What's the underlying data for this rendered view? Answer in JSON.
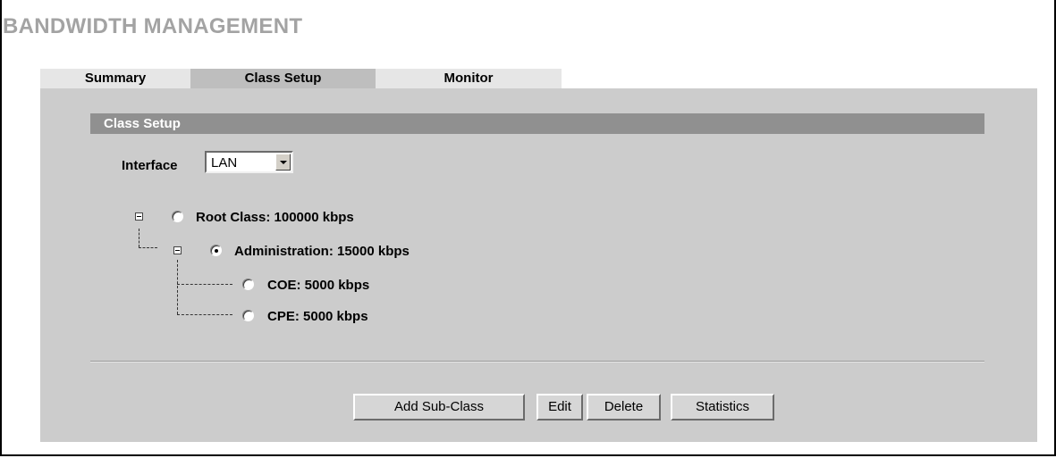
{
  "page": {
    "title": "BANDWIDTH MANAGEMENT"
  },
  "tabs": [
    {
      "label": "Summary",
      "active": false
    },
    {
      "label": "Class Setup",
      "active": true
    },
    {
      "label": "Monitor",
      "active": false
    }
  ],
  "section": {
    "title": "Class Setup"
  },
  "interface": {
    "label": "Interface",
    "selected": "LAN"
  },
  "tree": {
    "nodes": [
      {
        "label": "Root Class: 100000 kbps",
        "selected": false,
        "expandable": true
      },
      {
        "label": "Administration: 15000 kbps",
        "selected": true,
        "expandable": true
      },
      {
        "label": "COE: 5000 kbps",
        "selected": false,
        "expandable": false
      },
      {
        "label": "CPE: 5000 kbps",
        "selected": false,
        "expandable": false
      }
    ]
  },
  "buttons": {
    "add_sub_class": "Add Sub-Class",
    "edit": "Edit",
    "delete": "Delete",
    "statistics": "Statistics"
  }
}
